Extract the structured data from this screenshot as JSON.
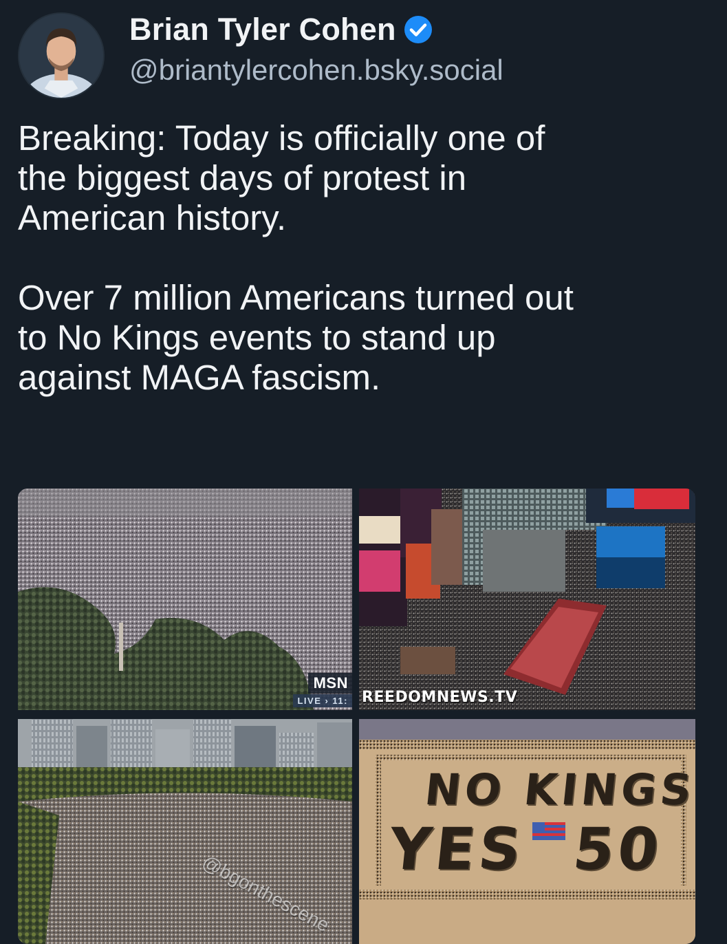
{
  "author": {
    "display_name": "Brian Tyler Cohen",
    "handle": "@briantylercohen.bsky.social",
    "verified": true,
    "avatar_icon": "profile-photo"
  },
  "post": {
    "paragraph_1": "Breaking: Today is officially one of the biggest days of protest in American history.",
    "paragraph_2": "Over 7 million Americans turned out to No Kings events to stand up against MAGA fascism.",
    "lines": [
      "Breaking: Today is officially one of",
      "the biggest days of protest in",
      "American history.",
      "Over 7 million Americans turned out",
      "to No Kings events to stand up",
      "against MAGA fascism."
    ]
  },
  "images": {
    "image_1": {
      "overlay_logo": "MSN",
      "overlay_live": "LIVE › 11:"
    },
    "image_2": {
      "watermark": "REEDOMNEWS.TV"
    },
    "image_3": {
      "watermark": "@bgonthescene"
    },
    "image_4": {
      "sand_line_1": "NO KINGS",
      "sand_line_2_left": "YES",
      "sand_line_2_right": "50"
    }
  },
  "colors": {
    "background": "#161e27",
    "text_primary": "#f1f3f5",
    "text_secondary": "#aebbc9",
    "verified_blue": "#1d8cf8"
  }
}
